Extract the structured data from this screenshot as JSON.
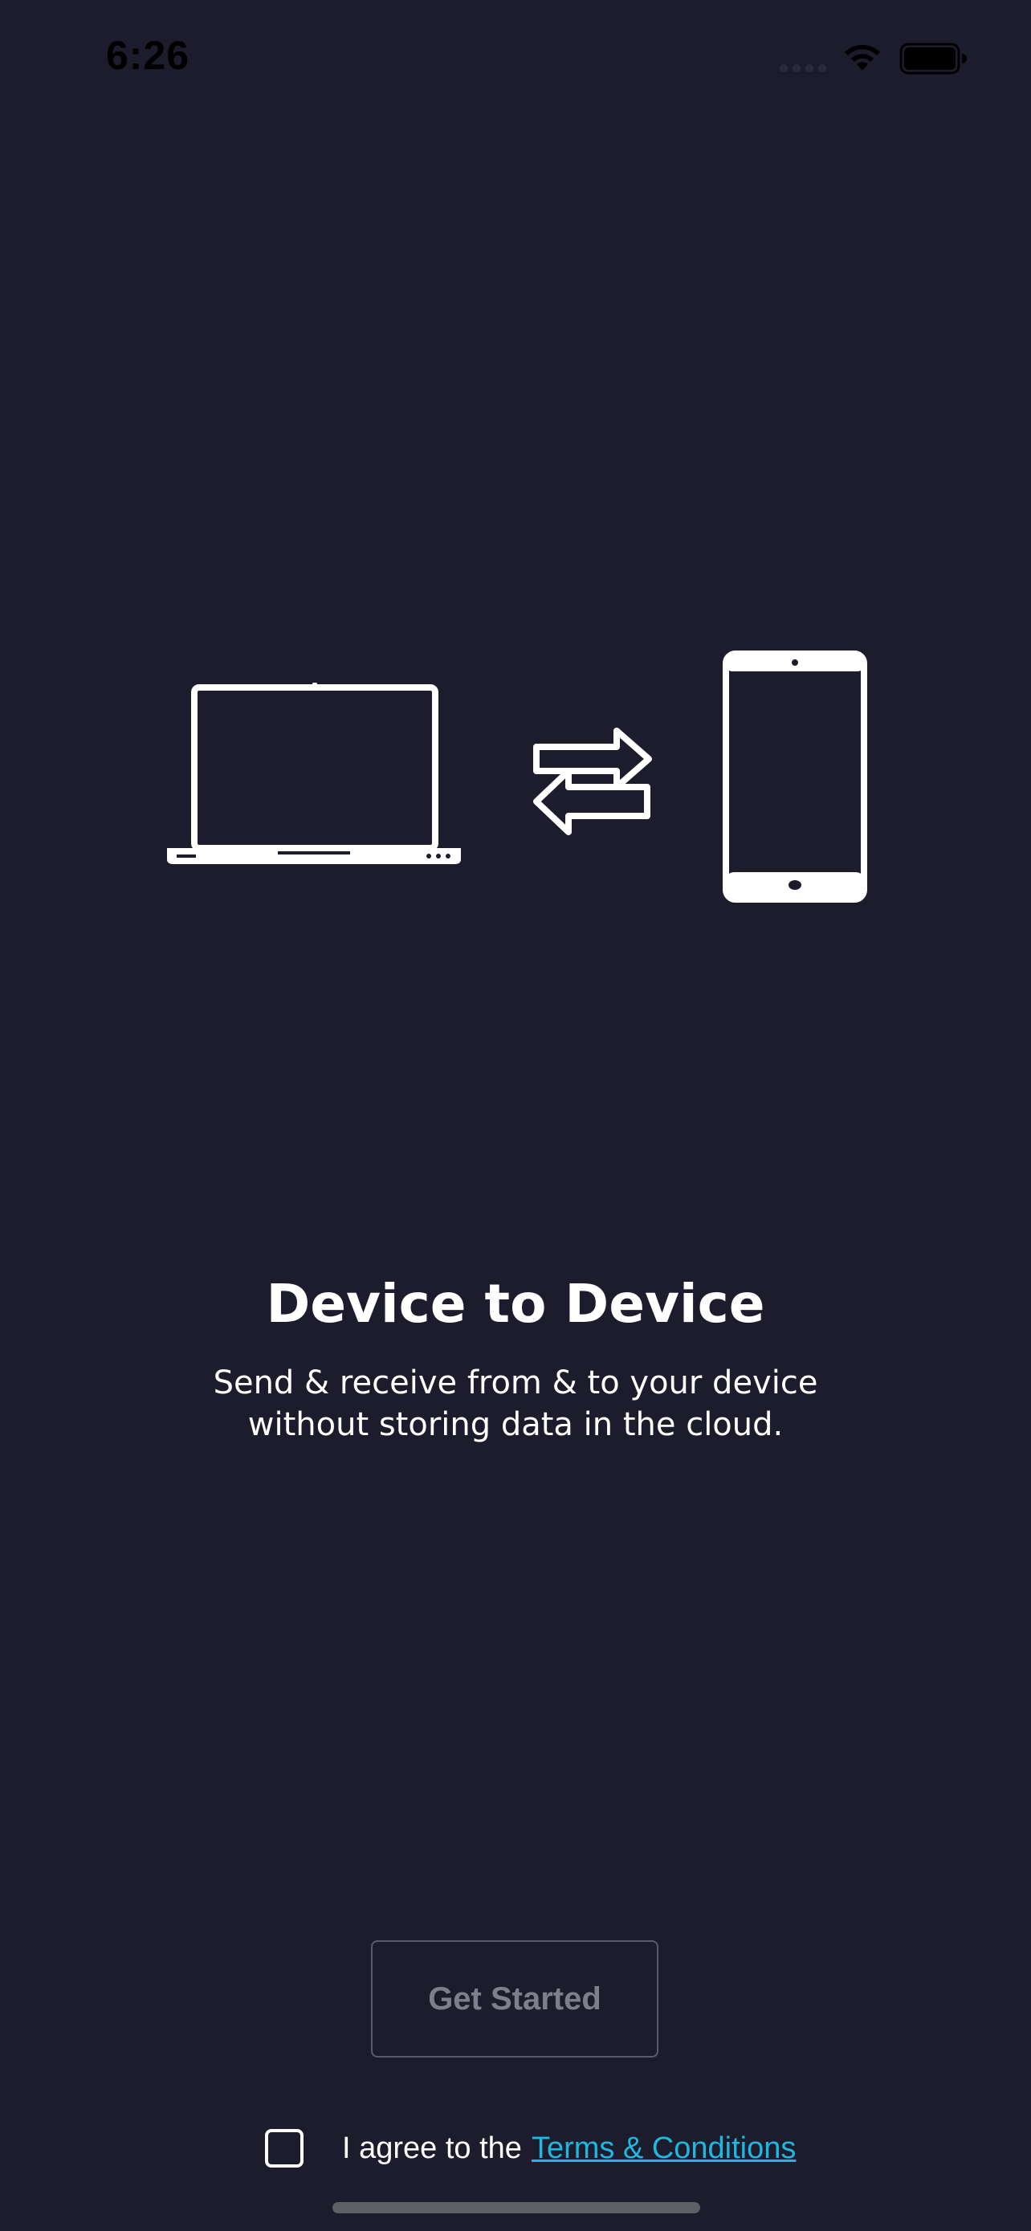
{
  "status_bar": {
    "time": "6:26"
  },
  "hero": {
    "icons": [
      "laptop-icon",
      "transfer-arrows-icon",
      "tablet-icon"
    ]
  },
  "onboarding": {
    "title": "Device to Device",
    "subtitle": "Send & receive from & to your device without storing data in the cloud."
  },
  "actions": {
    "get_started_label": "Get Started",
    "agree_text": "I agree to the",
    "terms_link": "Terms & Conditions",
    "agree_checked": false
  },
  "colors": {
    "background": "#1c1c2c",
    "link": "#1fb6e0",
    "button_disabled_text": "#7e7e8c",
    "button_border": "#5a5a6a"
  }
}
